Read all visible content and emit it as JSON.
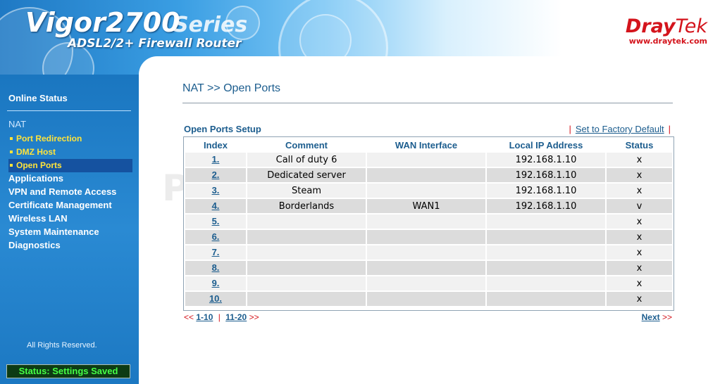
{
  "header": {
    "model": "Vigor2700",
    "series": "Series",
    "subtitle": "ADSL2/2+ Firewall Router",
    "brand_dray": "Dray",
    "brand_tek": "Tek",
    "brand_url": "www.draytek.com"
  },
  "sidebar": {
    "online_status": "Online Status",
    "nat": "NAT",
    "nat_items": [
      "Port Redirection",
      "DMZ Host",
      "Open Ports"
    ],
    "menu": [
      "Applications",
      "VPN and Remote Access",
      "Certificate Management",
      "Wireless LAN",
      "System Maintenance",
      "Diagnostics"
    ],
    "rights": "All Rights Reserved.",
    "status": "Status: Settings Saved"
  },
  "main": {
    "breadcrumb": "NAT >> Open Ports",
    "setup_title": "Open Ports Setup",
    "factory_link": "Set to Factory Default",
    "columns": [
      "Index",
      "Comment",
      "WAN Interface",
      "Local IP Address",
      "Status"
    ],
    "rows": [
      {
        "index": "1.",
        "comment": "Call of duty 6",
        "wan": "",
        "ip": "192.168.1.10",
        "status": "x"
      },
      {
        "index": "2.",
        "comment": "Dedicated server",
        "wan": "",
        "ip": "192.168.1.10",
        "status": "x"
      },
      {
        "index": "3.",
        "comment": "Steam",
        "wan": "",
        "ip": "192.168.1.10",
        "status": "x"
      },
      {
        "index": "4.",
        "comment": "Borderlands",
        "wan": "WAN1",
        "ip": "192.168.1.10",
        "status": "v"
      },
      {
        "index": "5.",
        "comment": "",
        "wan": "",
        "ip": "",
        "status": "x"
      },
      {
        "index": "6.",
        "comment": "",
        "wan": "",
        "ip": "",
        "status": "x"
      },
      {
        "index": "7.",
        "comment": "",
        "wan": "",
        "ip": "",
        "status": "x"
      },
      {
        "index": "8.",
        "comment": "",
        "wan": "",
        "ip": "",
        "status": "x"
      },
      {
        "index": "9.",
        "comment": "",
        "wan": "",
        "ip": "",
        "status": "x"
      },
      {
        "index": "10.",
        "comment": "",
        "wan": "",
        "ip": "",
        "status": "x"
      }
    ],
    "pager": {
      "prev_arrows": "<<",
      "page1": "1-10",
      "separator": "|",
      "page2": "11-20",
      "next_arrows": ">>",
      "next_label": "Next"
    },
    "watermark": "PowerTech.com"
  }
}
